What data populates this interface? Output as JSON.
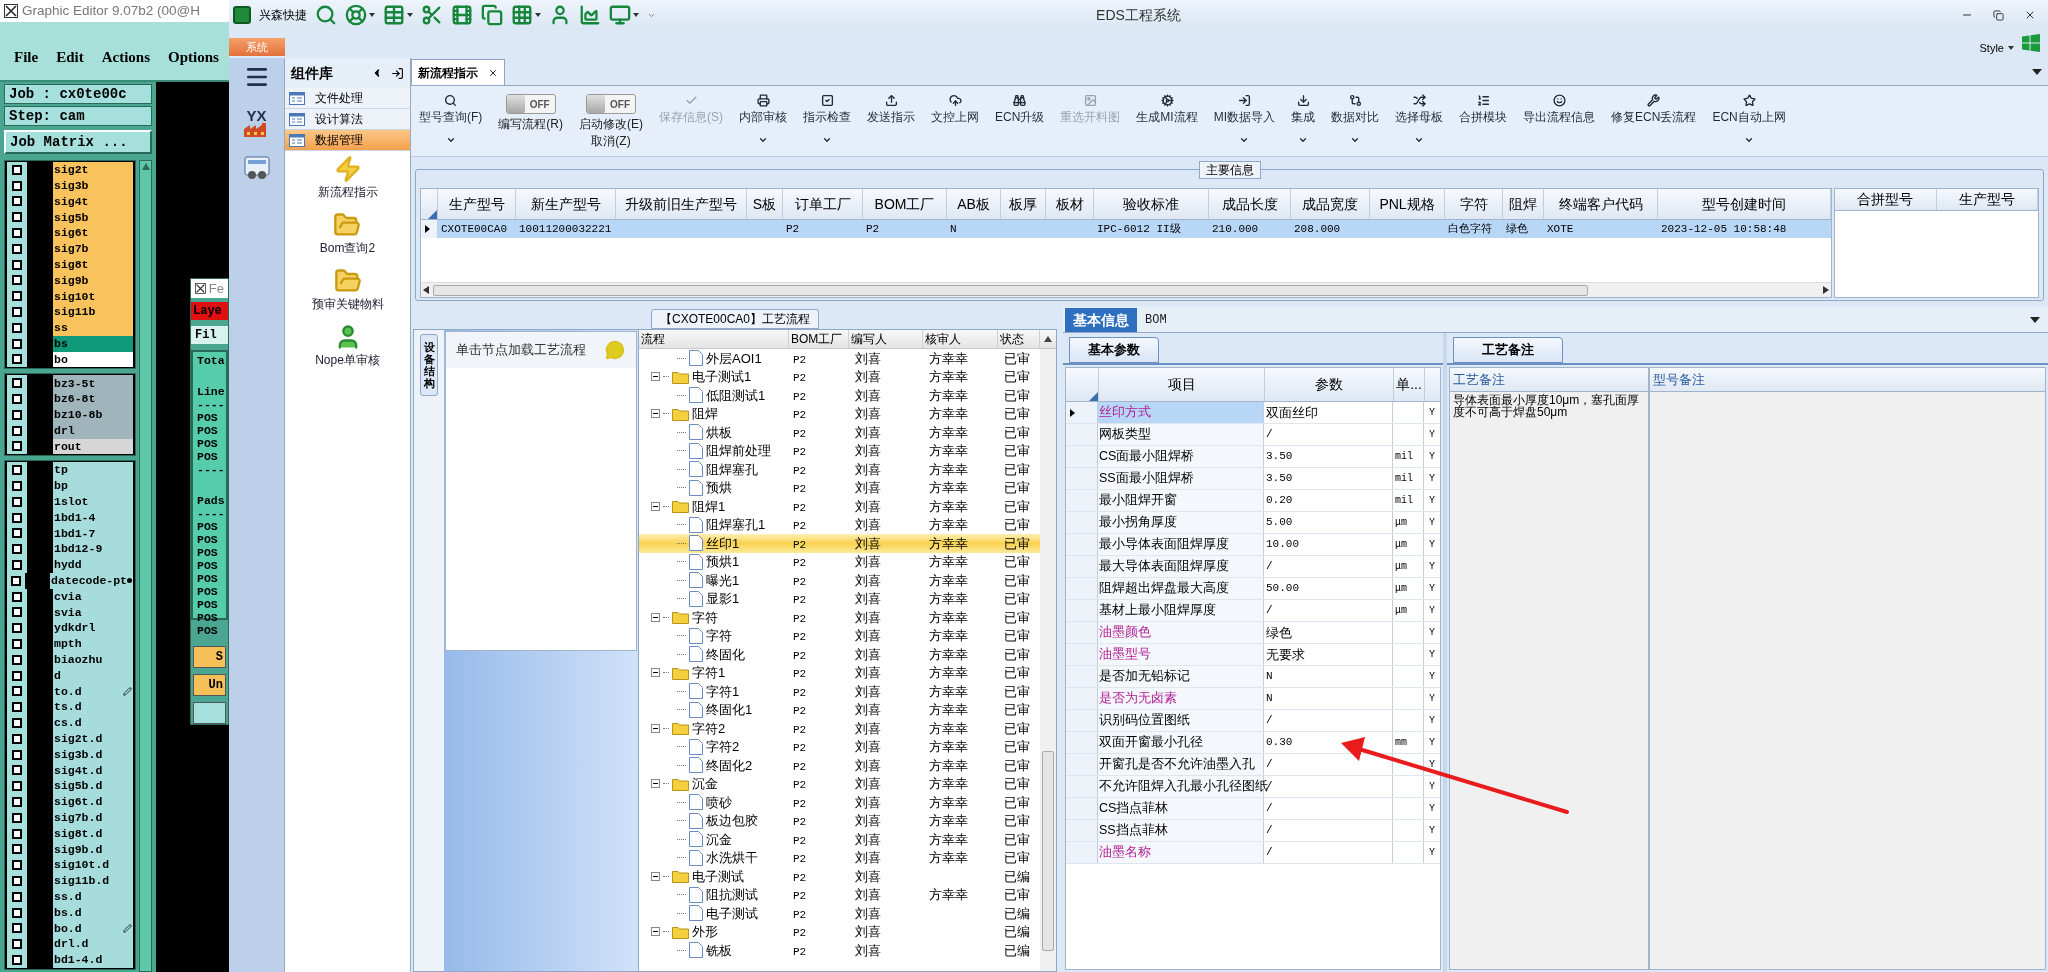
{
  "editor": {
    "title": "Graphic Editor 9.07b2 (00@H",
    "menu": [
      "File",
      "Edit",
      "Actions",
      "Options"
    ],
    "job": "Job : cx0te00c",
    "step": "Step: cam",
    "matrix_button": "Job Matrix ...",
    "layer_groups": [
      {
        "layers": [
          {
            "name": "sig2t",
            "color": "#f8c25c",
            "checked": false
          },
          {
            "name": "sig3b",
            "color": "#f8c25c",
            "checked": false
          },
          {
            "name": "sig4t",
            "color": "#f8c25c",
            "checked": false
          },
          {
            "name": "sig5b",
            "color": "#f8c25c",
            "checked": false
          },
          {
            "name": "sig6t",
            "color": "#f8c25c",
            "checked": false
          },
          {
            "name": "sig7b",
            "color": "#f8c25c",
            "checked": false
          },
          {
            "name": "sig8t",
            "color": "#f8c25c",
            "checked": false
          },
          {
            "name": "sig9b",
            "color": "#f8c25c",
            "checked": false
          },
          {
            "name": "sig10t",
            "color": "#f8c25c",
            "checked": false
          },
          {
            "name": "sig11b",
            "color": "#f8c25c",
            "checked": false
          },
          {
            "name": "ss",
            "color": "#f8c25c",
            "checked": false
          },
          {
            "name": "bs",
            "color": "#0e9a78",
            "checked": false
          },
          {
            "name": "bo",
            "color": "#ffffff",
            "checked": false
          }
        ]
      },
      {
        "layers": [
          {
            "name": "bz3-5t",
            "color": "#a0b4bc",
            "checked": false
          },
          {
            "name": "bz6-8t",
            "color": "#a0b4bc",
            "checked": false
          },
          {
            "name": "bz10-8b",
            "color": "#a0b4bc",
            "checked": false
          },
          {
            "name": "drl",
            "color": "#a0b4bc",
            "checked": false
          },
          {
            "name": "rout",
            "color": "#d6d6d6",
            "checked": false
          }
        ]
      },
      {
        "layers": [
          {
            "name": "tp",
            "color": "#a6dcdc",
            "checked": false
          },
          {
            "name": "bp",
            "color": "#a6dcdc",
            "checked": false
          },
          {
            "name": "1slot",
            "color": "#a6dcdc",
            "checked": false
          },
          {
            "name": "1bd1-4",
            "color": "#a6dcdc",
            "checked": false
          },
          {
            "name": "1bd1-7",
            "color": "#a6dcdc",
            "checked": false
          },
          {
            "name": "1bd12-9",
            "color": "#a6dcdc",
            "checked": false
          },
          {
            "name": "hydd",
            "color": "#a6dcdc",
            "checked": false
          },
          {
            "name": "datecode-pt",
            "color": "#a6dcdc",
            "checked": false,
            "dotted": true
          },
          {
            "name": "cvia",
            "color": "#a6dcdc",
            "checked": false
          },
          {
            "name": "svia",
            "color": "#a6dcdc",
            "checked": false
          },
          {
            "name": "ydkdrl",
            "color": "#a6dcdc",
            "checked": false
          },
          {
            "name": "mpth",
            "color": "#a6dcdc",
            "checked": false
          },
          {
            "name": "biaozhu",
            "color": "#a6dcdc",
            "checked": false
          },
          {
            "name": "d",
            "color": "#a6dcdc",
            "checked": false
          },
          {
            "name": "to.d",
            "color": "#a6dcdc",
            "checked": false,
            "pinned": true
          },
          {
            "name": "ts.d",
            "color": "#a6dcdc",
            "checked": false
          },
          {
            "name": "cs.d",
            "color": "#a6dcdc",
            "checked": false
          },
          {
            "name": "sig2t.d",
            "color": "#a6dcdc",
            "checked": false
          },
          {
            "name": "sig3b.d",
            "color": "#a6dcdc",
            "checked": false
          },
          {
            "name": "sig4t.d",
            "color": "#a6dcdc",
            "checked": false
          },
          {
            "name": "sig5b.d",
            "color": "#a6dcdc",
            "checked": false
          },
          {
            "name": "sig6t.d",
            "color": "#a6dcdc",
            "checked": false
          },
          {
            "name": "sig7b.d",
            "color": "#a6dcdc",
            "checked": false
          },
          {
            "name": "sig8t.d",
            "color": "#a6dcdc",
            "checked": false
          },
          {
            "name": "sig9b.d",
            "color": "#a6dcdc",
            "checked": false
          },
          {
            "name": "sig10t.d",
            "color": "#a6dcdc",
            "checked": false
          },
          {
            "name": "sig11b.d",
            "color": "#a6dcdc",
            "checked": false
          },
          {
            "name": "ss.d",
            "color": "#a6dcdc",
            "checked": false
          },
          {
            "name": "bs.d",
            "color": "#a6dcdc",
            "checked": false
          },
          {
            "name": "bo.d",
            "color": "#a6dcdc",
            "checked": false,
            "pinned": true
          },
          {
            "name": "drl.d",
            "color": "#a6dcdc",
            "checked": false
          },
          {
            "name": "bd1-4.d",
            "color": "#a6dcdc",
            "checked": false
          }
        ]
      }
    ],
    "inner_window": {
      "title": "Fe",
      "layer_label": "Laye",
      "menu": "Fil",
      "report": [
        {
          "lines": [
            "Tota"
          ]
        },
        {
          "lines": [
            "Line",
            "----",
            "POS",
            "POS",
            "POS",
            "POS",
            "----"
          ]
        },
        {
          "lines": [
            "Pads",
            "----",
            "POS",
            "POS",
            "POS",
            "POS",
            "POS",
            "POS",
            "POS",
            "POS",
            "POS"
          ]
        }
      ],
      "buttons": [
        "S",
        "Un"
      ]
    }
  },
  "app": {
    "name": "兴森快捷",
    "title": "EDS工程系统",
    "menu_tab": "系统",
    "style": "Style",
    "strip_logo": "YX"
  },
  "library": {
    "title": "组件库",
    "items": [
      {
        "label": "文件处理",
        "selected": false
      },
      {
        "label": "设计算法",
        "selected": false
      },
      {
        "label": "数据管理",
        "selected": true
      }
    ],
    "tools": [
      {
        "label": "新流程指示",
        "kind": "bolt"
      },
      {
        "label": "Bom查询2",
        "kind": "folder"
      },
      {
        "label": "预审关键物料",
        "kind": "folder"
      },
      {
        "label": "Nope单审核",
        "kind": "person"
      }
    ]
  },
  "tabs": [
    {
      "label": "新流程指示",
      "selected": true
    }
  ],
  "ribbon": [
    {
      "kind": "button",
      "label": "型号查询(F)",
      "disabled": false,
      "dropdown": true
    },
    {
      "kind": "toggle",
      "state": "OFF",
      "on": false,
      "label": "编写流程(R)"
    },
    {
      "kind": "toggle",
      "state": "OFF",
      "on": false,
      "label": "启动修改(E)",
      "sublabel": "取消(Z)"
    },
    {
      "kind": "button",
      "label": "保存信息(S)",
      "disabled": true,
      "dropdown": false
    },
    {
      "kind": "button",
      "label": "内部审核",
      "disabled": false,
      "dropdown": true
    },
    {
      "kind": "button",
      "label": "指示检查",
      "disabled": false,
      "dropdown": true
    },
    {
      "kind": "button",
      "label": "发送指示",
      "disabled": false,
      "dropdown": false
    },
    {
      "kind": "button",
      "label": "文控上网",
      "disabled": false,
      "dropdown": false
    },
    {
      "kind": "button",
      "label": "ECN升级",
      "disabled": false,
      "dropdown": false
    },
    {
      "kind": "button",
      "label": "重选开料图",
      "disabled": true,
      "dropdown": false
    },
    {
      "kind": "button",
      "label": "生成MI流程",
      "disabled": false,
      "dropdown": false
    },
    {
      "kind": "button",
      "label": "MI数据导入",
      "disabled": false,
      "dropdown": true
    },
    {
      "kind": "button",
      "label": "集成",
      "disabled": false,
      "dropdown": true
    },
    {
      "kind": "button",
      "label": "数据对比",
      "disabled": false,
      "dropdown": true
    },
    {
      "kind": "button",
      "label": "选择母板",
      "disabled": false,
      "dropdown": true
    },
    {
      "kind": "button",
      "label": "合拼模块",
      "disabled": false,
      "dropdown": false
    },
    {
      "kind": "button",
      "label": "导出流程信息",
      "disabled": false,
      "dropdown": false
    },
    {
      "kind": "button",
      "label": "修复ECN丢流程",
      "disabled": false,
      "dropdown": false
    },
    {
      "kind": "button",
      "label": "ECN自动上网",
      "disabled": false,
      "dropdown": true
    }
  ],
  "main_info": {
    "title": "主要信息",
    "columns": [
      "生产型号",
      "新生产型号",
      "升级前旧生产型号",
      "S板",
      "订单工厂",
      "BOM工厂",
      "AB板",
      "板厚",
      "板材",
      "验收标准",
      "成品长度",
      "成品宽度",
      "PNL规格",
      "字符",
      "阻焊",
      "终端客户代码",
      "型号创建时间"
    ],
    "rows": [
      {
        "selected": true,
        "cells": [
          "CXOTE00CA0",
          "10011200032221",
          null,
          null,
          "P2",
          "P2",
          "N",
          null,
          null,
          "IPC-6012 II级",
          "210.000",
          "208.000",
          null,
          "白色字符",
          "绿色",
          "XOTE",
          "2023-12-05 10:58:48"
        ]
      }
    ],
    "side_columns": [
      "合拼型号",
      "生产型号"
    ]
  },
  "process": {
    "title": "【CXOTE00CA0】工艺流程",
    "side_tab": "设备结构",
    "hint": "单击节点加载工艺流程",
    "columns": [
      "流程",
      "BOM工厂",
      "编写人",
      "核审人",
      "状态"
    ],
    "rows": [
      {
        "kind": "step",
        "name": "外层AOI1",
        "factory": "P2",
        "writer": "刘喜",
        "reviewer": "方幸幸",
        "status": "已审",
        "selected": false
      },
      {
        "kind": "group",
        "name": "电子测试1",
        "factory": "P2",
        "writer": "刘喜",
        "reviewer": "方幸幸",
        "status": "已审",
        "selected": false,
        "expanded": true,
        "children": [
          {
            "kind": "step",
            "name": "低阻测试1",
            "factory": "P2",
            "writer": "刘喜",
            "reviewer": "方幸幸",
            "status": "已审",
            "selected": false
          }
        ]
      },
      {
        "kind": "group",
        "name": "阻焊",
        "factory": "P2",
        "writer": "刘喜",
        "reviewer": "方幸幸",
        "status": "已审",
        "selected": false,
        "expanded": true,
        "children": [
          {
            "kind": "step",
            "name": "烘板",
            "factory": "P2",
            "writer": "刘喜",
            "reviewer": "方幸幸",
            "status": "已审",
            "selected": false
          },
          {
            "kind": "step",
            "name": "阻焊前处理",
            "factory": "P2",
            "writer": "刘喜",
            "reviewer": "方幸幸",
            "status": "已审",
            "selected": false
          },
          {
            "kind": "step",
            "name": "阻焊塞孔",
            "factory": "P2",
            "writer": "刘喜",
            "reviewer": "方幸幸",
            "status": "已审",
            "selected": false
          },
          {
            "kind": "step",
            "name": "预烘",
            "factory": "P2",
            "writer": "刘喜",
            "reviewer": "方幸幸",
            "status": "已审",
            "selected": false
          }
        ]
      },
      {
        "kind": "group",
        "name": "阻焊1",
        "factory": "P2",
        "writer": "刘喜",
        "reviewer": "方幸幸",
        "status": "已审",
        "selected": false,
        "expanded": true,
        "children": [
          {
            "kind": "step",
            "name": "阻焊塞孔1",
            "factory": "P2",
            "writer": "刘喜",
            "reviewer": "方幸幸",
            "status": "已审",
            "selected": false
          },
          {
            "kind": "step",
            "name": "丝印1",
            "factory": "P2",
            "writer": "刘喜",
            "reviewer": "方幸幸",
            "status": "已审",
            "selected": true
          },
          {
            "kind": "step",
            "name": "预烘1",
            "factory": "P2",
            "writer": "刘喜",
            "reviewer": "方幸幸",
            "status": "已审",
            "selected": false
          },
          {
            "kind": "step",
            "name": "曝光1",
            "factory": "P2",
            "writer": "刘喜",
            "reviewer": "方幸幸",
            "status": "已审",
            "selected": false
          },
          {
            "kind": "step",
            "name": "显影1",
            "factory": "P2",
            "writer": "刘喜",
            "reviewer": "方幸幸",
            "status": "已审",
            "selected": false
          }
        ]
      },
      {
        "kind": "group",
        "name": "字符",
        "factory": "P2",
        "writer": "刘喜",
        "reviewer": "方幸幸",
        "status": "已审",
        "selected": false,
        "expanded": true,
        "children": [
          {
            "kind": "step",
            "name": "字符",
            "factory": "P2",
            "writer": "刘喜",
            "reviewer": "方幸幸",
            "status": "已审",
            "selected": false
          },
          {
            "kind": "step",
            "name": "终固化",
            "factory": "P2",
            "writer": "刘喜",
            "reviewer": "方幸幸",
            "status": "已审",
            "selected": false
          }
        ]
      },
      {
        "kind": "group",
        "name": "字符1",
        "factory": "P2",
        "writer": "刘喜",
        "reviewer": "方幸幸",
        "status": "已审",
        "selected": false,
        "expanded": true,
        "children": [
          {
            "kind": "step",
            "name": "字符1",
            "factory": "P2",
            "writer": "刘喜",
            "reviewer": "方幸幸",
            "status": "已审",
            "selected": false
          },
          {
            "kind": "step",
            "name": "终固化1",
            "factory": "P2",
            "writer": "刘喜",
            "reviewer": "方幸幸",
            "status": "已审",
            "selected": false
          }
        ]
      },
      {
        "kind": "group",
        "name": "字符2",
        "factory": "P2",
        "writer": "刘喜",
        "reviewer": "方幸幸",
        "status": "已审",
        "selected": false,
        "expanded": true,
        "children": [
          {
            "kind": "step",
            "name": "字符2",
            "factory": "P2",
            "writer": "刘喜",
            "reviewer": "方幸幸",
            "status": "已审",
            "selected": false
          },
          {
            "kind": "step",
            "name": "终固化2",
            "factory": "P2",
            "writer": "刘喜",
            "reviewer": "方幸幸",
            "status": "已审",
            "selected": false
          }
        ]
      },
      {
        "kind": "group",
        "name": "沉金",
        "factory": "P2",
        "writer": "刘喜",
        "reviewer": "方幸幸",
        "status": "已审",
        "selected": false,
        "expanded": true,
        "children": [
          {
            "kind": "step",
            "name": "喷砂",
            "factory": "P2",
            "writer": "刘喜",
            "reviewer": "方幸幸",
            "status": "已审",
            "selected": false
          },
          {
            "kind": "step",
            "name": "板边包胶",
            "factory": "P2",
            "writer": "刘喜",
            "reviewer": "方幸幸",
            "status": "已审",
            "selected": false
          },
          {
            "kind": "step",
            "name": "沉金",
            "factory": "P2",
            "writer": "刘喜",
            "reviewer": "方幸幸",
            "status": "已审",
            "selected": false
          },
          {
            "kind": "step",
            "name": "水洗烘干",
            "factory": "P2",
            "writer": "刘喜",
            "reviewer": "方幸幸",
            "status": "已审",
            "selected": false
          }
        ]
      },
      {
        "kind": "group",
        "name": "电子测试",
        "factory": "P2",
        "writer": "刘喜",
        "status": "已编",
        "selected": false,
        "expanded": true,
        "children": [
          {
            "kind": "step",
            "name": "阻抗测试",
            "factory": "P2",
            "writer": "刘喜",
            "reviewer": "方幸幸",
            "status": "已审",
            "selected": false
          },
          {
            "kind": "step",
            "name": "电子测试",
            "factory": "P2",
            "writer": "刘喜",
            "status": "已编",
            "selected": false
          }
        ]
      },
      {
        "kind": "group",
        "name": "外形",
        "factory": "P2",
        "writer": "刘喜",
        "status": "已编",
        "selected": false,
        "expanded": true,
        "children": [
          {
            "kind": "step",
            "name": "铣板",
            "factory": "P2",
            "writer": "刘喜",
            "status": "已编",
            "selected": false
          }
        ]
      }
    ]
  },
  "detail": {
    "tabs": [
      {
        "label": "基本信息",
        "selected": true
      },
      {
        "label": "BOM",
        "selected": false
      }
    ],
    "params": {
      "tab": "基本参数",
      "columns": [
        "项目",
        "参数",
        "单..."
      ],
      "rows": [
        {
          "item": "丝印方式",
          "value": "双面丝印",
          "flag": "Y",
          "emphasis": true,
          "selected": true
        },
        {
          "item": "网板类型",
          "value": "/",
          "flag": "Y",
          "emphasis": false,
          "selected": false
        },
        {
          "item": "CS面最小阻焊桥",
          "value": "3.50",
          "unit": "mil",
          "flag": "Y",
          "emphasis": false,
          "selected": false
        },
        {
          "item": "SS面最小阻焊桥",
          "value": "3.50",
          "unit": "mil",
          "flag": "Y",
          "emphasis": false,
          "selected": false
        },
        {
          "item": "最小阻焊开窗",
          "value": "0.20",
          "unit": "mil",
          "flag": "Y",
          "emphasis": false,
          "selected": false
        },
        {
          "item": "最小拐角厚度",
          "value": "5.00",
          "unit": "μm",
          "flag": "Y",
          "emphasis": false,
          "selected": false
        },
        {
          "item": "最小导体表面阻焊厚度",
          "value": "10.00",
          "unit": "μm",
          "flag": "Y",
          "emphasis": false,
          "selected": false
        },
        {
          "item": "最大导体表面阻焊厚度",
          "value": "/",
          "unit": "μm",
          "flag": "Y",
          "emphasis": false,
          "selected": false
        },
        {
          "item": "阻焊超出焊盘最大高度",
          "value": "50.00",
          "unit": "μm",
          "flag": "Y",
          "emphasis": false,
          "selected": false
        },
        {
          "item": "基材上最小阻焊厚度",
          "value": "/",
          "unit": "μm",
          "flag": "Y",
          "emphasis": false,
          "selected": false
        },
        {
          "item": "油墨颜色",
          "value": "绿色",
          "flag": "Y",
          "emphasis": true,
          "selected": false
        },
        {
          "item": "油墨型号",
          "value": "无要求",
          "flag": "Y",
          "emphasis": true,
          "selected": false
        },
        {
          "item": "是否加无铅标记",
          "value": "N",
          "flag": "Y",
          "emphasis": false,
          "selected": false
        },
        {
          "item": "是否为无卤素",
          "value": "N",
          "flag": "Y",
          "emphasis": true,
          "selected": false
        },
        {
          "item": "识别码位置图纸",
          "value": "/",
          "flag": "Y",
          "emphasis": false,
          "selected": false
        },
        {
          "item": "双面开窗最小孔径",
          "value": "0.30",
          "unit": "mm",
          "flag": "Y",
          "emphasis": false,
          "selected": false
        },
        {
          "item": "开窗孔是否不允许油墨入孔",
          "value": "/",
          "flag": "Y",
          "emphasis": false,
          "selected": false
        },
        {
          "item": "不允许阻焊入孔最小孔径图纸",
          "value": "/",
          "flag": "Y",
          "emphasis": false,
          "selected": false
        },
        {
          "item": "CS挡点菲林",
          "value": "/",
          "flag": "Y",
          "emphasis": false,
          "selected": false
        },
        {
          "item": "SS挡点菲林",
          "value": "/",
          "flag": "Y",
          "emphasis": false,
          "selected": false
        },
        {
          "item": "油墨名称",
          "value": "/",
          "flag": "Y",
          "emphasis": true,
          "selected": false
        }
      ]
    },
    "notes": {
      "tab": "工艺备注",
      "columns": [
        "工艺备注",
        "型号备注"
      ],
      "process_note": "导体表面最小厚度10μm，塞孔面厚度不可高于焊盘50μm"
    }
  }
}
